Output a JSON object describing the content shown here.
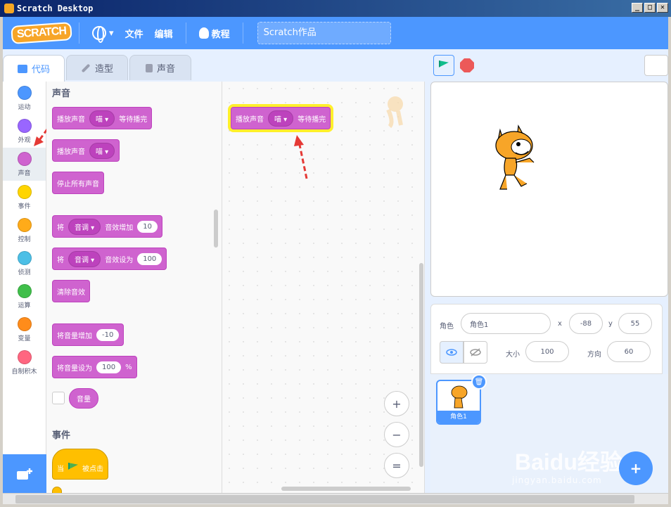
{
  "window": {
    "title": "Scratch Desktop",
    "controls": [
      "_",
      "□",
      "✕"
    ]
  },
  "menubar": {
    "logo": "SCRATCH",
    "file": "文件",
    "edit": "编辑",
    "tutorials": "教程",
    "project_title": "Scratch作品"
  },
  "tabs": [
    {
      "label": "代码",
      "icon": "code-icon",
      "active": true
    },
    {
      "label": "造型",
      "icon": "brush-icon"
    },
    {
      "label": "声音",
      "icon": "speaker-icon"
    }
  ],
  "categories": [
    {
      "label": "运动",
      "color": "#4c97ff"
    },
    {
      "label": "外观",
      "color": "#9966ff"
    },
    {
      "label": "声音",
      "color": "#cf63cf",
      "active": true
    },
    {
      "label": "事件",
      "color": "#ffd500"
    },
    {
      "label": "控制",
      "color": "#ffab19"
    },
    {
      "label": "侦测",
      "color": "#4cbfe6"
    },
    {
      "label": "运算",
      "color": "#40bf4a"
    },
    {
      "label": "变量",
      "color": "#ff8c1a"
    },
    {
      "label": "自制积木",
      "color": "#ff6680"
    }
  ],
  "palette": {
    "sound_heading": "声音",
    "events_heading": "事件",
    "blocks": {
      "play_until_done": {
        "prefix": "播放声音",
        "sound": "喵",
        "suffix": "等待播完"
      },
      "start_sound": {
        "prefix": "播放声音",
        "sound": "喵"
      },
      "stop_all": "停止所有声音",
      "change_effect": {
        "prefix": "将",
        "effect": "音调",
        "suffix": "音效增加",
        "value": "10"
      },
      "set_effect": {
        "prefix": "将",
        "effect": "音调",
        "suffix": "音效设为",
        "value": "100"
      },
      "clear_effects": "清除音效",
      "change_volume": {
        "label": "将音量增加",
        "value": "-10"
      },
      "set_volume": {
        "label": "将音量设为",
        "value": "100",
        "unit": "%"
      },
      "volume_reporter": "音量",
      "when_flag": {
        "prefix": "当",
        "suffix": "被点击"
      }
    }
  },
  "workspace": {
    "block": {
      "prefix": "播放声音",
      "sound": "喵",
      "suffix": "等待播完"
    },
    "zoom_in": "+",
    "zoom_out": "−",
    "zoom_reset": "="
  },
  "sprite_info": {
    "sprite_label": "角色",
    "sprite_name": "角色1",
    "x_label": "x",
    "x_value": "-88",
    "y_label": "y",
    "y_value": "55",
    "size_label": "大小",
    "size_value": "100",
    "direction_label": "方向",
    "direction_value": "60"
  },
  "sprites": [
    {
      "name": "角色1",
      "selected": true
    }
  ],
  "watermark": {
    "line1": "Baidu经验",
    "line2": "jingyan.baidu.com"
  }
}
